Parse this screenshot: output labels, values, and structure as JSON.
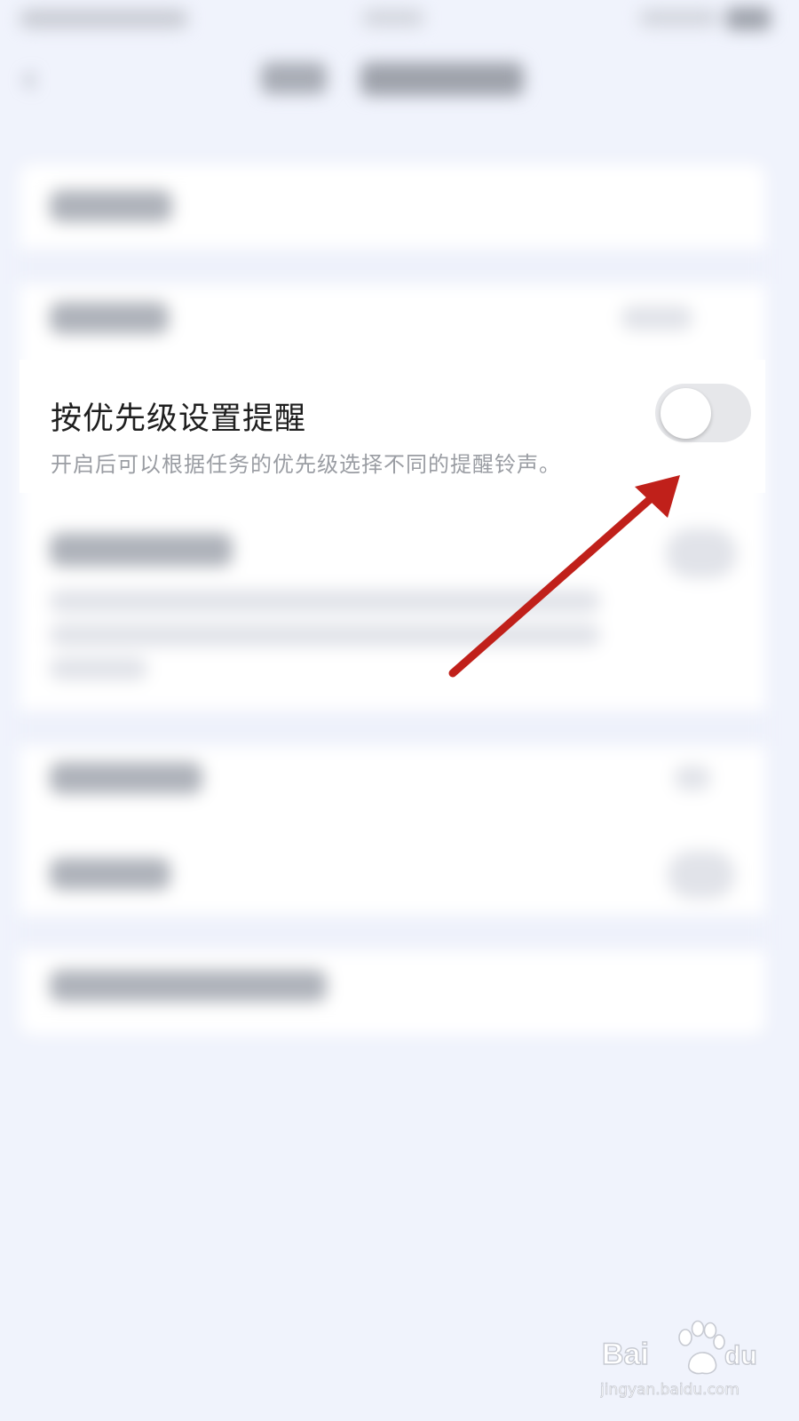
{
  "setting": {
    "title": "按优先级设置提醒",
    "description": "开启后可以根据任务的优先级选择不同的提醒铃声。",
    "toggle_on": false
  },
  "watermark": {
    "brand": "Baidu经验",
    "url": "jingyan.baidu.com"
  },
  "colors": {
    "background": "#f0f3fc",
    "card": "#ffffff",
    "toggle_off_track": "#e6e7ea",
    "arrow": "#c0201a",
    "description_text": "#9a9da3"
  },
  "icons": {
    "back": "back-arrow-icon",
    "annotation": "red-arrow-icon",
    "watermark": "baidu-paw-logo"
  }
}
